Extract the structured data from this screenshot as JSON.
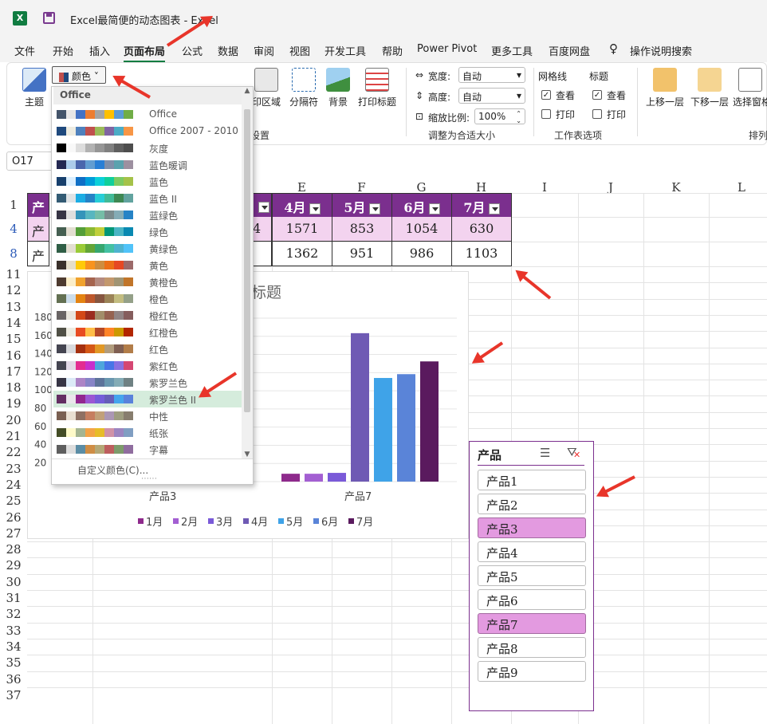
{
  "app": {
    "title": "Excel最简便的动态图表  -  Excel",
    "logo": "X"
  },
  "menu": [
    "文件",
    "开始",
    "插入",
    "页面布局",
    "公式",
    "数据",
    "审阅",
    "视图",
    "开发工具",
    "帮助",
    "Power Pivot",
    "更多工具",
    "百度网盘",
    "操作说明搜索"
  ],
  "ribbon": {
    "theme_label": "主题",
    "colors_label": "颜色",
    "print_area": "印区域",
    "breaks": "分隔符",
    "background": "背景",
    "print_titles": "打印标题",
    "width_label": "宽度:",
    "width_value": "自动",
    "height_label": "高度:",
    "height_value": "自动",
    "scale_label": "缩放比例:",
    "scale_value": "100%",
    "fit_group": "调整为合适大小",
    "setup_group": "设置",
    "gridlines": "网格线",
    "headings": "标题",
    "view": "查看",
    "print": "打印",
    "sheet_options_group": "工作表选项",
    "bring_forward": "上移一层",
    "send_backward": "下移一层",
    "selection_pane": "选择窗格",
    "arrange_group": "排列"
  },
  "namebox": "O17",
  "columns": [
    "E",
    "F",
    "G",
    "H",
    "I",
    "J",
    "K",
    "L"
  ],
  "rows": [
    "1",
    "4",
    "8",
    "11",
    "12",
    "13",
    "14",
    "15",
    "16",
    "17",
    "18",
    "19",
    "20",
    "21",
    "22",
    "23",
    "24",
    "25",
    "26",
    "27",
    "28",
    "29",
    "30",
    "31",
    "32",
    "33",
    "34",
    "35",
    "36",
    "37"
  ],
  "table": {
    "headers": [
      "4月",
      "5月",
      "6月",
      "7月"
    ],
    "row4": [
      "1571",
      "853",
      "1054",
      "630"
    ],
    "row8": [
      "1362",
      "951",
      "986",
      "1103"
    ],
    "left_fragments": [
      "产",
      "产",
      "产"
    ],
    "fragment_4": "4"
  },
  "chart_data": {
    "type": "bar",
    "title": "标题",
    "categories": [
      "产品3",
      "产品7"
    ],
    "series": [
      {
        "name": "1月",
        "color": "#8e2a8c",
        "values": [
          null,
          72
        ]
      },
      {
        "name": "2月",
        "color": "#a35fd2",
        "values": [
          null,
          72
        ]
      },
      {
        "name": "3月",
        "color": "#7a5ad8",
        "values": [
          null,
          80
        ]
      },
      {
        "name": "4月",
        "color": "#6f5ab4",
        "values": [
          null,
          1362
        ]
      },
      {
        "name": "5月",
        "color": "#3fa3e8",
        "values": [
          null,
          951
        ]
      },
      {
        "name": "6月",
        "color": "#5a84d8",
        "values": [
          null,
          986
        ]
      },
      {
        "name": "7月",
        "color": "#5a1a5e",
        "values": [
          null,
          1103
        ]
      }
    ],
    "yticks": [
      "180",
      "160",
      "140",
      "120",
      "100",
      "80",
      "60",
      "40",
      "20"
    ],
    "legend": "bottom",
    "grid": true
  },
  "colors_menu": {
    "header": "Office",
    "custom": "自定义颜色(C)...",
    "items": [
      {
        "name": "Office",
        "colors": [
          "#44546a",
          "#e7e6e6",
          "#4472c4",
          "#ed7d31",
          "#a5a5a5",
          "#ffc000",
          "#5b9bd5",
          "#70ad47"
        ]
      },
      {
        "name": "Office 2007 - 2010",
        "colors": [
          "#1f497d",
          "#eeece1",
          "#4f81bd",
          "#c0504d",
          "#9bbb59",
          "#8064a2",
          "#4bacc6",
          "#f79646"
        ]
      },
      {
        "name": "灰度",
        "colors": [
          "#000000",
          "#f8f8f8",
          "#dddddd",
          "#b2b2b2",
          "#969696",
          "#808080",
          "#5f5f5f",
          "#4d4d4d"
        ]
      },
      {
        "name": "蓝色暖调",
        "colors": [
          "#242852",
          "#acccea",
          "#4a66ac",
          "#629dd1",
          "#297fd5",
          "#7f8fa9",
          "#5aa2ae",
          "#9d90a0"
        ]
      },
      {
        "name": "蓝色",
        "colors": [
          "#17406d",
          "#dbefff",
          "#0f6fc6",
          "#009dd9",
          "#0bd0d9",
          "#10cf9b",
          "#7cca62",
          "#a5c249"
        ]
      },
      {
        "name": "蓝色 II",
        "colors": [
          "#335b74",
          "#dfe3e5",
          "#1cade4",
          "#2683c6",
          "#27ced7",
          "#42ba97",
          "#3e8853",
          "#62a39f"
        ]
      },
      {
        "name": "蓝绿色",
        "colors": [
          "#373545",
          "#dedede",
          "#3494ba",
          "#58b6c0",
          "#75bda7",
          "#7a8c8e",
          "#84acb6",
          "#2683c6"
        ]
      },
      {
        "name": "绿色",
        "colors": [
          "#455f51",
          "#e3ded1",
          "#549e39",
          "#8ab833",
          "#c0cf3a",
          "#029676",
          "#4ab5c4",
          "#0989b1"
        ]
      },
      {
        "name": "黄绿色",
        "colors": [
          "#2f5e46",
          "#e3ded1",
          "#99cb38",
          "#63a537",
          "#37a76f",
          "#44c1a3",
          "#4eb3cf",
          "#51c3f9"
        ]
      },
      {
        "name": "黄色",
        "colors": [
          "#39302a",
          "#e5dec9",
          "#ffca08",
          "#f8931d",
          "#ce8d3e",
          "#ec7016",
          "#e64823",
          "#9c6a6a"
        ]
      },
      {
        "name": "黄橙色",
        "colors": [
          "#4e3b30",
          "#fbeec9",
          "#f0a22e",
          "#a5644e",
          "#b58b80",
          "#c3986d",
          "#a19574",
          "#c17529"
        ]
      },
      {
        "name": "橙色",
        "colors": [
          "#637052",
          "#ccddea",
          "#e48312",
          "#bd582c",
          "#865640",
          "#9b8357",
          "#c2bc80",
          "#94a088"
        ]
      },
      {
        "name": "橙红色",
        "colors": [
          "#696464",
          "#e9e5dc",
          "#d34817",
          "#9b2d1f",
          "#a28e6a",
          "#956251",
          "#918485",
          "#855d5d"
        ]
      },
      {
        "name": "红橙色",
        "colors": [
          "#505046",
          "#eeece1",
          "#e84c22",
          "#ffbd47",
          "#b64926",
          "#ff8427",
          "#cc9900",
          "#b22600"
        ]
      },
      {
        "name": "红色",
        "colors": [
          "#454551",
          "#d8d9dc",
          "#a5300f",
          "#d55816",
          "#e19825",
          "#b19c7d",
          "#7f5f52",
          "#b27d49"
        ]
      },
      {
        "name": "紫红色",
        "colors": [
          "#454551",
          "#e2d9e7",
          "#e32d91",
          "#c830cc",
          "#4ea6dc",
          "#4775e7",
          "#8971e1",
          "#d54773"
        ]
      },
      {
        "name": "紫罗兰色",
        "colors": [
          "#373545",
          "#dceaf7",
          "#ad84c6",
          "#8784c7",
          "#5d739a",
          "#6997af",
          "#84acb6",
          "#6f8183"
        ]
      },
      {
        "name": "紫罗兰色 II",
        "colors": [
          "#632e62",
          "#eae5eb",
          "#92278f",
          "#9b57d3",
          "#755dd9",
          "#665eb8",
          "#45a5ed",
          "#5982db"
        ]
      },
      {
        "name": "中性",
        "colors": [
          "#7a5f51",
          "#e9ded1",
          "#8f7063",
          "#c67e60",
          "#c1a079",
          "#ab97b4",
          "#9e9d80",
          "#877d6e"
        ]
      },
      {
        "name": "纸张",
        "colors": [
          "#444d26",
          "#fefac9",
          "#a5b592",
          "#f3a447",
          "#e7bc29",
          "#d092a7",
          "#9c85c0",
          "#809ec2"
        ]
      },
      {
        "name": "字幕",
        "colors": [
          "#5e5e5e",
          "#dddddd",
          "#5b8da5",
          "#cf8d45",
          "#b4a877",
          "#bd5e5e",
          "#7d9b6b",
          "#8f6d9e"
        ]
      }
    ]
  },
  "slicer": {
    "title": "产品",
    "items": [
      "产品1",
      "产品2",
      "产品3",
      "产品4",
      "产品5",
      "产品6",
      "产品7",
      "产品8",
      "产品9"
    ],
    "selected": [
      "产品3",
      "产品7"
    ]
  }
}
